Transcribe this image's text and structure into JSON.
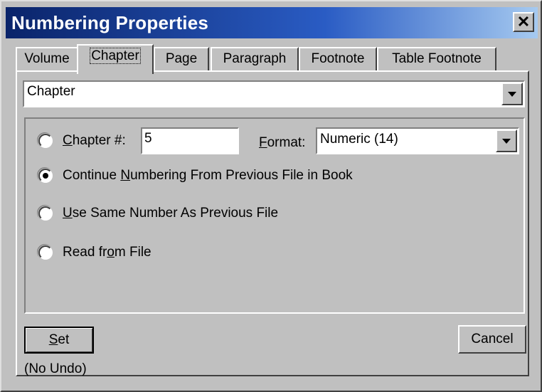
{
  "window": {
    "title": "Numbering Properties",
    "close_glyph": "✕"
  },
  "tabs": [
    {
      "label": "Volume"
    },
    {
      "label": "Chapter",
      "active": true
    },
    {
      "label": "Page"
    },
    {
      "label": "Paragraph"
    },
    {
      "label": "Footnote"
    },
    {
      "label": "Table Footnote"
    }
  ],
  "component_select": {
    "value": "Chapter"
  },
  "options": {
    "chapter_number": {
      "mnemonic": "C",
      "rest": "hapter #:",
      "value": "5",
      "selected": false
    },
    "format": {
      "mnemonic": "F",
      "rest": "ormat:",
      "value": "Numeric  (14)"
    },
    "continue": {
      "before": "Continue ",
      "mnemonic": "N",
      "after": "umbering From Previous File in Book",
      "selected": true
    },
    "same": {
      "mnemonic": "U",
      "after": "se Same Number As Previous File",
      "selected": false
    },
    "read": {
      "before": "Read fr",
      "mnemonic": "o",
      "after": "m File",
      "selected": false
    }
  },
  "buttons": {
    "set": {
      "mnemonic": "S",
      "rest": "et"
    },
    "set_note": "(No Undo)",
    "cancel": "Cancel"
  },
  "icons": {
    "dropdown": "chevron-down-icon",
    "close": "close-icon"
  }
}
